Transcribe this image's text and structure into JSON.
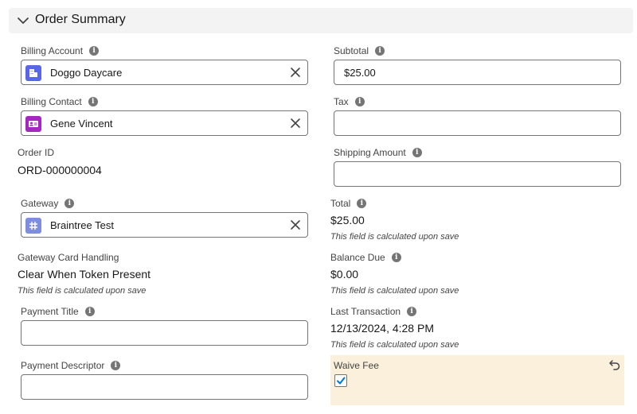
{
  "section": {
    "title": "Order Summary",
    "icon": "chevron-down-icon"
  },
  "left": {
    "billing_account": {
      "label": "Billing Account",
      "value": "Doggo Daycare",
      "icon": "account-icon",
      "icon_color": "#5867e8"
    },
    "billing_contact": {
      "label": "Billing Contact",
      "value": "Gene Vincent",
      "icon": "contact-icon",
      "icon_color": "#a626c2"
    },
    "order_id": {
      "label": "Order ID",
      "value": "ORD-000000004"
    },
    "gateway": {
      "label": "Gateway",
      "value": "Braintree Test",
      "icon": "hash-icon",
      "icon_color": "#7f8de1"
    },
    "card_handling": {
      "label": "Gateway Card Handling",
      "value": "Clear When Token Present",
      "note": "This field is calculated upon save"
    },
    "payment_title": {
      "label": "Payment Title",
      "value": ""
    },
    "payment_descriptor": {
      "label": "Payment Descriptor",
      "value": ""
    }
  },
  "right": {
    "subtotal": {
      "label": "Subtotal",
      "value": "$25.00"
    },
    "tax": {
      "label": "Tax",
      "value": ""
    },
    "shipping": {
      "label": "Shipping Amount",
      "value": ""
    },
    "total": {
      "label": "Total",
      "value": "$25.00",
      "note": "This field is calculated upon save"
    },
    "balance_due": {
      "label": "Balance Due",
      "value": "$0.00",
      "note": "This field is calculated upon save"
    },
    "last_transaction": {
      "label": "Last Transaction",
      "value": "12/13/2024, 4:28 PM",
      "note": "This field is calculated upon save"
    },
    "waive_fee": {
      "label": "Waive Fee",
      "checked": true,
      "highlight_color": "#faf0dc"
    }
  },
  "colors": {
    "accent": "#0176d3",
    "border": "#747474"
  }
}
